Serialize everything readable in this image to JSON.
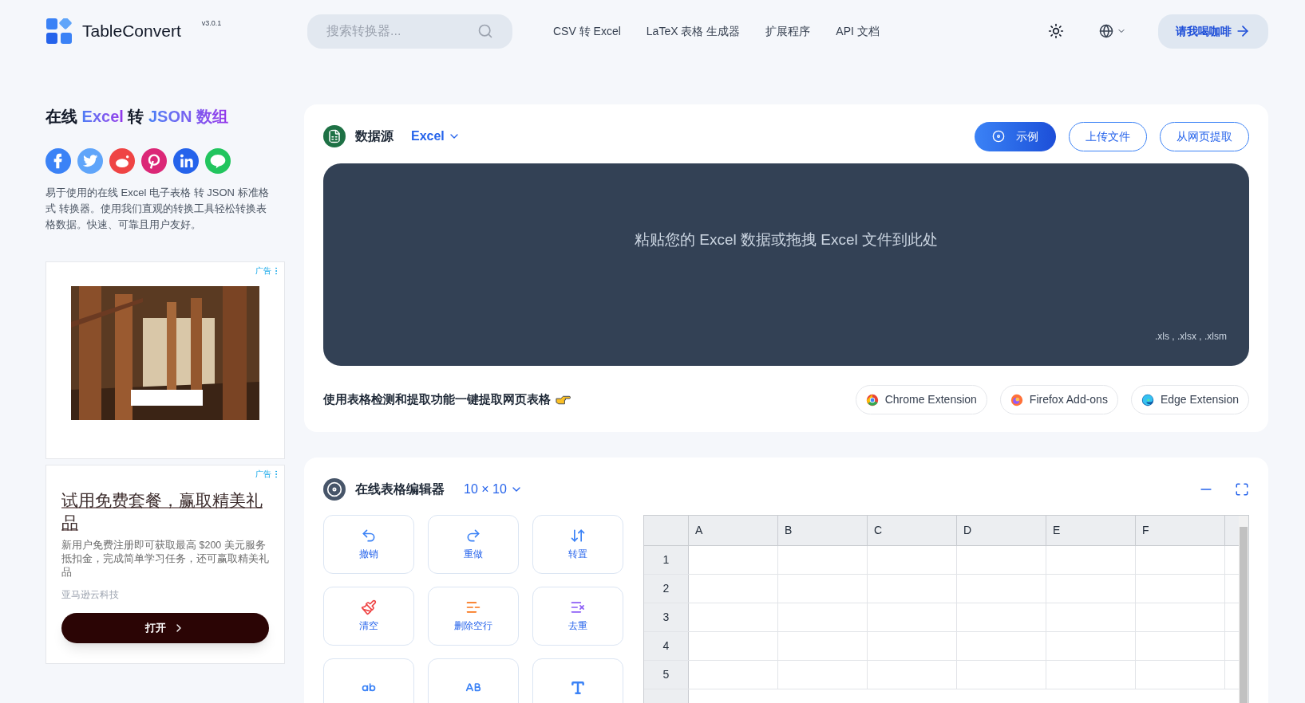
{
  "header": {
    "logo_text": "TableConvert",
    "version": "v3.0.1",
    "search": {
      "placeholder": "搜索转换器..."
    },
    "nav": [
      "CSV 转 Excel",
      "LaTeX 表格 生成器",
      "扩展程序",
      "API 文档"
    ],
    "coffee_button": "请我喝咖啡"
  },
  "sidebar": {
    "title_parts": [
      {
        "text": "在线",
        "accent": false
      },
      {
        "text": "Excel",
        "accent": true
      },
      {
        "text": "转",
        "accent": false
      },
      {
        "text": "JSON 数组",
        "accent": true
      }
    ],
    "social": [
      {
        "kind": "facebook",
        "color": "#3b82f6"
      },
      {
        "kind": "twitter",
        "color": "#60a5fa"
      },
      {
        "kind": "reddit",
        "color": "#ef4444"
      },
      {
        "kind": "pinterest",
        "color": "#db2777"
      },
      {
        "kind": "linkedin",
        "color": "#2563eb"
      },
      {
        "kind": "line",
        "color": "#22c55e"
      }
    ],
    "description": "易于使用的在线 Excel 电子表格 转 JSON 标准格式 转换器。使用我们直观的转换工具轻松转换表格数据。快速、可靠且用户友好。",
    "ads": [
      {
        "kind": "banner",
        "label": "广告"
      },
      {
        "kind": "text",
        "label": "广告",
        "headline": "试用免费套餐，赢取精美礼品",
        "body": "新用户免费注册即可获取最高 $200 美元服务抵扣金，完成简单学习任务，还可赢取精美礼品",
        "advertiser": "亚马逊云科技",
        "button": "打开"
      }
    ]
  },
  "source": {
    "title": "数据源",
    "format": "Excel",
    "buttons": [
      {
        "label": "示例",
        "primary": true
      },
      {
        "label": "上传文件",
        "primary": false
      },
      {
        "label": "从网页提取",
        "primary": false
      }
    ],
    "dropzone": {
      "text": "粘贴您的 Excel 数据或拖拽 Excel 文件到此处",
      "extensions": ".xls , .xlsx , .xlsm"
    },
    "extract_text": "使用表格检测和提取功能一键提取网页表格",
    "extensions": [
      {
        "kind": "chrome",
        "label": "Chrome Extension"
      },
      {
        "kind": "firefox",
        "label": "Firefox Add-ons"
      },
      {
        "kind": "edge",
        "label": "Edge Extension"
      }
    ]
  },
  "editor": {
    "title": "在线表格编辑器",
    "size": "10 × 10",
    "tools": [
      {
        "kind": "undo",
        "label": "撤销",
        "color": "#3b82f6"
      },
      {
        "kind": "redo",
        "label": "重做",
        "color": "#3b82f6"
      },
      {
        "kind": "transpose",
        "label": "转置",
        "color": "#3b82f6"
      },
      {
        "kind": "clear",
        "label": "清空",
        "color": "#ef4444"
      },
      {
        "kind": "remove-empty",
        "label": "删除空行",
        "color": "#f97316"
      },
      {
        "kind": "dedupe",
        "label": "去重",
        "color": "#8b5cf6"
      },
      {
        "kind": "lowercase",
        "color": "#3b82f6"
      },
      {
        "kind": "uppercase",
        "color": "#3b82f6"
      },
      {
        "kind": "text",
        "color": "#3b82f6"
      }
    ],
    "grid": {
      "columns": [
        "A",
        "B",
        "C",
        "D",
        "E",
        "F"
      ],
      "rows": [
        "1",
        "2",
        "3",
        "4",
        "5"
      ]
    }
  }
}
